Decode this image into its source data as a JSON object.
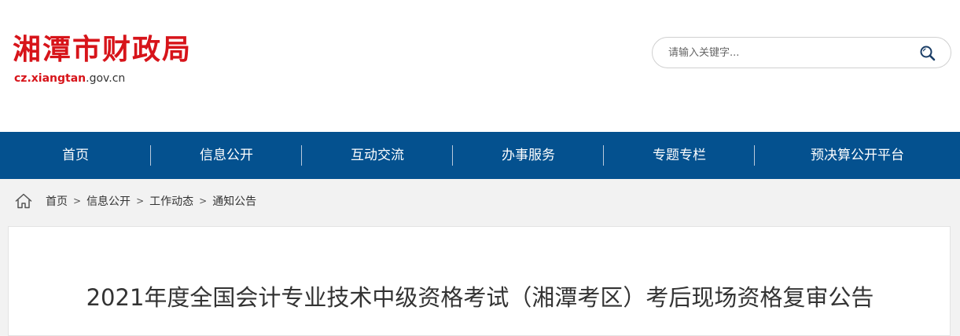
{
  "header": {
    "site_title": "湘潭市财政局",
    "domain_accent": "cz.xiangtan",
    "domain_rest": ".gov.cn"
  },
  "search": {
    "placeholder": "请输入关键字..."
  },
  "icons": {
    "search": "search-icon",
    "home": "home-icon"
  },
  "nav": {
    "items": [
      {
        "label": "首页"
      },
      {
        "label": "信息公开"
      },
      {
        "label": "互动交流"
      },
      {
        "label": "办事服务"
      },
      {
        "label": "专题专栏"
      },
      {
        "label": "预决算公开平台"
      }
    ]
  },
  "breadcrumb": {
    "items": [
      {
        "label": "首页"
      },
      {
        "label": "信息公开"
      },
      {
        "label": "工作动态"
      },
      {
        "label": "通知公告"
      }
    ],
    "separator": ">"
  },
  "article": {
    "title": "2021年度全国会计专业技术中级资格考试（湘潭考区）考后现场资格复审公告"
  },
  "colors": {
    "brand_red": "#d7141a",
    "nav_blue": "#04518f"
  }
}
